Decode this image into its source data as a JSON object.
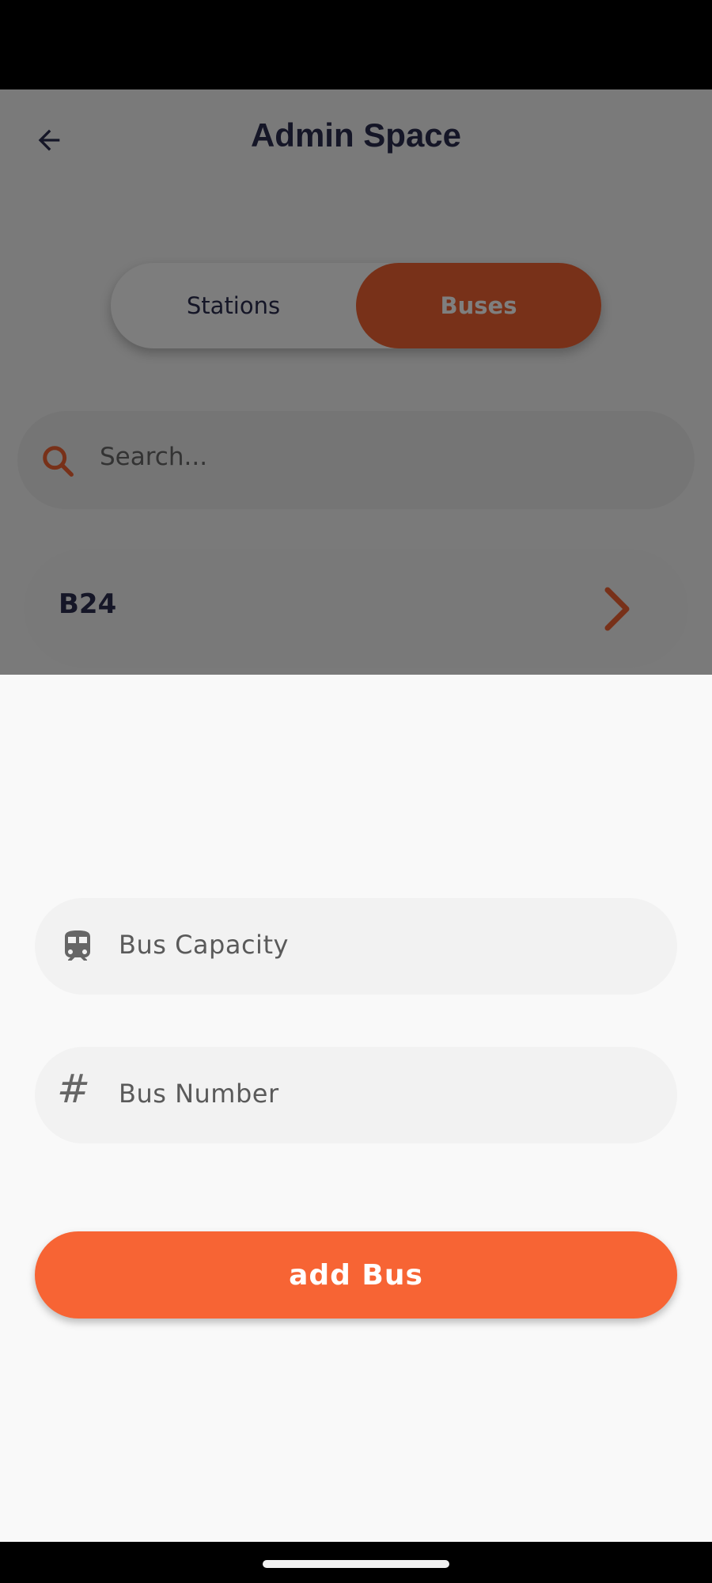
{
  "header": {
    "title": "Admin Space"
  },
  "tabs": [
    {
      "label": "Stations",
      "selected": false
    },
    {
      "label": "Buses",
      "selected": true
    }
  ],
  "search": {
    "placeholder": "Search..."
  },
  "list": {
    "items": [
      {
        "label": "B24"
      }
    ]
  },
  "sheet": {
    "capacity_placeholder": "Bus Capacity",
    "number_placeholder": "Bus Number",
    "number_icon_glyph": "#",
    "submit_label": "add Bus"
  },
  "colors": {
    "accent": "#f76434",
    "title": "#2a2c4e",
    "scrim": "rgba(0,0,0,0.5)"
  },
  "icons": {
    "back": "arrow-left-icon",
    "search": "search-icon",
    "chevron": "chevron-right-icon",
    "capacity": "train-icon",
    "number": "hash-icon"
  }
}
